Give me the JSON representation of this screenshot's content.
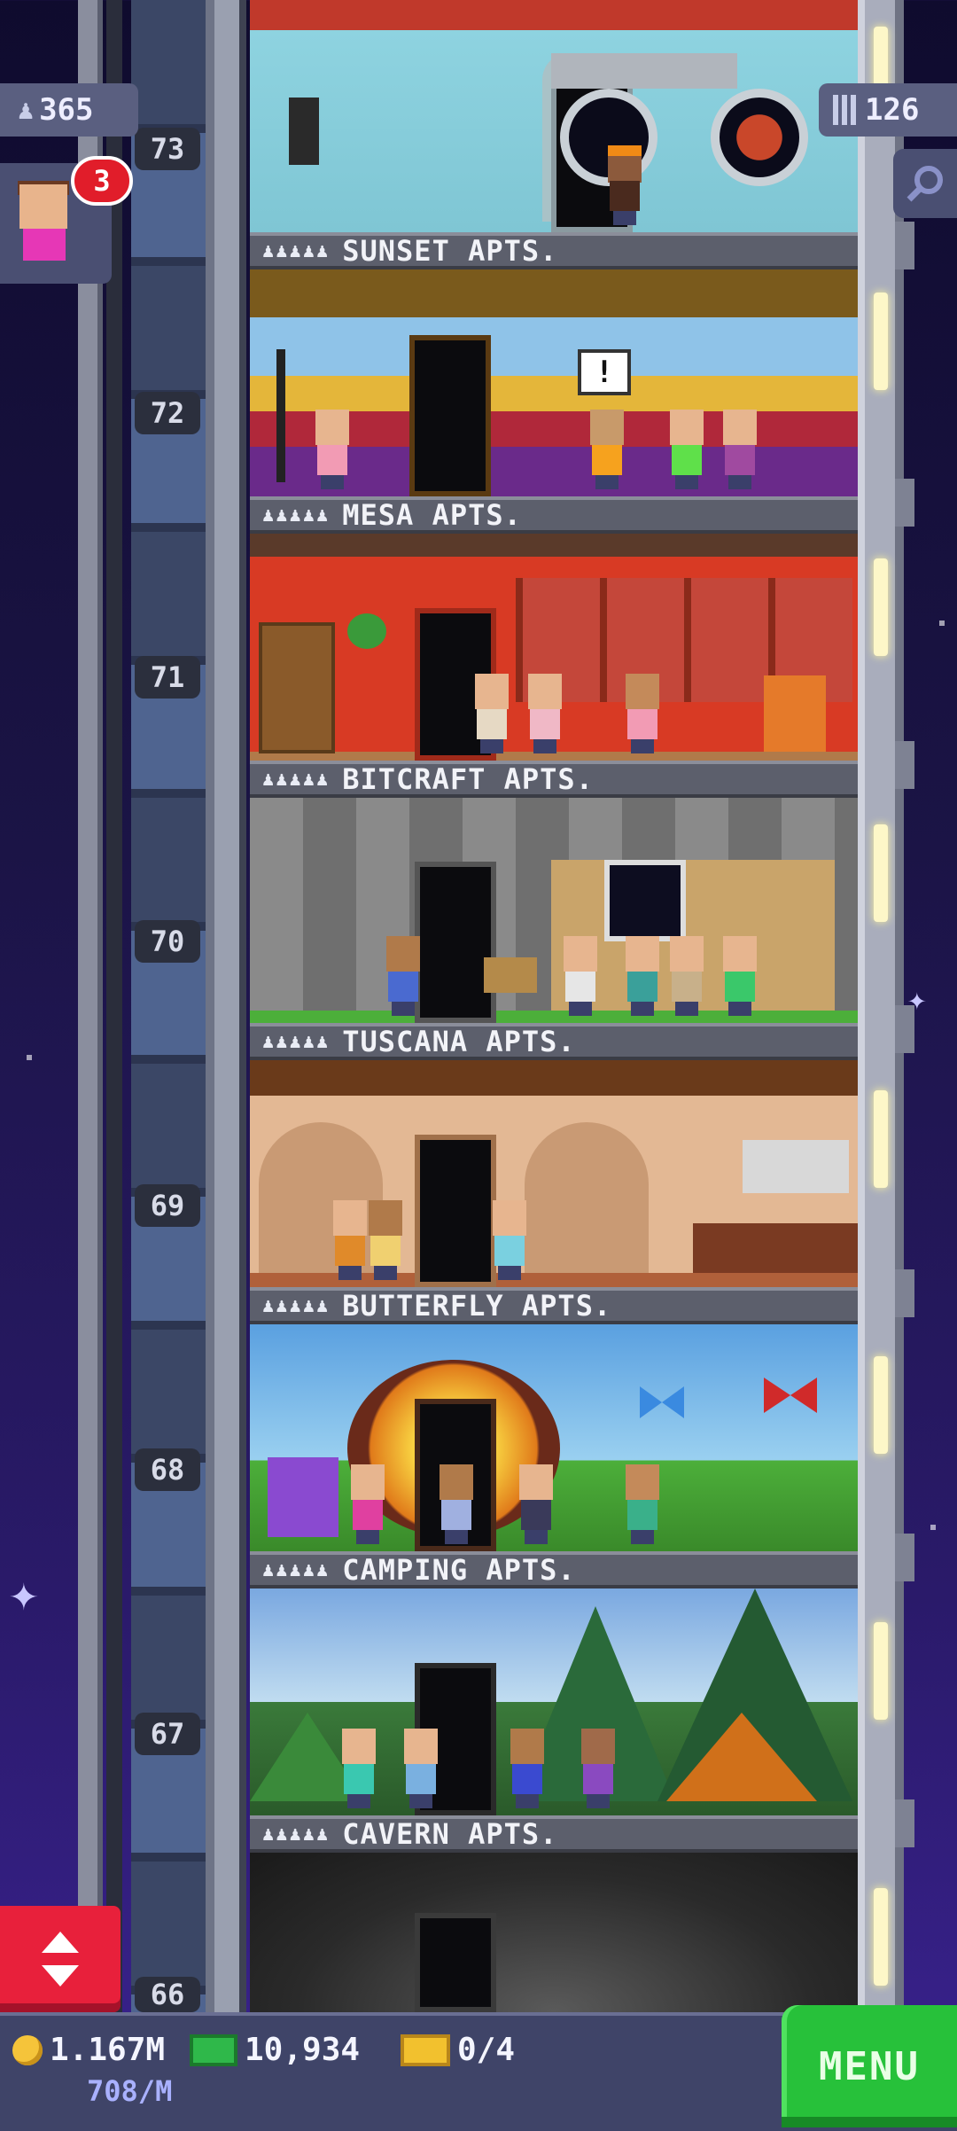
{
  "hud": {
    "population": "365",
    "floor_count": "126",
    "notification_count": "3",
    "coins": "1.167M",
    "coin_rate": "708/M",
    "tower_bux": "10,934",
    "tickets": "0/4",
    "menu_label": "MENU"
  },
  "floor_numbers": [
    "73",
    "72",
    "71",
    "70",
    "69",
    "68",
    "67",
    "66"
  ],
  "floors": [
    {
      "name": "SUNSET APTS.",
      "people": "♟♟♟♟♟"
    },
    {
      "name": "MESA APTS.",
      "people": "♟♟♟♟♟"
    },
    {
      "name": "BITCRAFT APTS.",
      "people": "♟♟♟♟♟"
    },
    {
      "name": "TUSCANA APTS.",
      "people": "♟♟♟♟♟"
    },
    {
      "name": "BUTTERFLY APTS.",
      "people": "♟♟♟♟♟"
    },
    {
      "name": "CAMPING APTS.",
      "people": "♟♟♟♟♟"
    },
    {
      "name": "CAVERN APTS.",
      "people": "♟♟♟♟♟"
    }
  ],
  "alert_mark": "!",
  "colors": {
    "accent_red": "#e8203b",
    "menu_green": "#27c13a",
    "hud_panel": "#3f4468"
  }
}
